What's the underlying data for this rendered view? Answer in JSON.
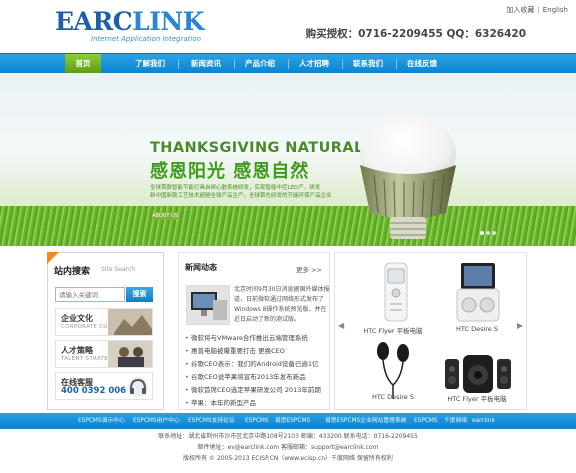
{
  "header": {
    "logo_main": "EARC",
    "logo_rest": "LINK",
    "logo_sub": "Internet Application Integration",
    "top_links": [
      "加入收藏",
      "English"
    ],
    "phone": "购买授权：0716-2209455 QQ：6326420"
  },
  "nav": {
    "items": [
      {
        "label": "首页",
        "active": true
      },
      {
        "label": "了解我们",
        "active": false
      },
      {
        "label": "新闻资讯",
        "active": false
      },
      {
        "label": "产品介绍",
        "active": false
      },
      {
        "label": "人才招聘",
        "active": false
      },
      {
        "label": "联系我们",
        "active": false
      },
      {
        "label": "在线反馈",
        "active": false
      }
    ]
  },
  "banner": {
    "headline_en": "THANKSGIVING NATURAL",
    "headline_cn": "感恩阳光 感恩自然",
    "body_lines": [
      "全球首款智能节能灯具自研心脏系统研发，实现智能中控LED产，研发",
      "新中国新款工艺技术超越全球产品生产，全球首先研发的节能环保产品企业"
    ],
    "more_label": "ABOUT US"
  },
  "search": {
    "title": "站内搜索",
    "subtitle": "Site Search",
    "placeholder": "请输入关键词",
    "button": "搜索"
  },
  "side_boxes": [
    {
      "cn": "企业文化",
      "en": "CORPORATE CULTURE"
    },
    {
      "cn": "人才策略",
      "en": "TALENT STRATEGY"
    },
    {
      "cn": "在线客服",
      "big": "400 0392 006"
    }
  ],
  "news": {
    "title": "新闻动态",
    "more": "更多 >>",
    "excerpt": "北京时间9月30日消息据国外媒体报道，日前微软通过网络形式发布了Windows 8操作系统预览版，并在近日启动了新的测试版。",
    "items": [
      "微软将与VMware合作推出云端管理系统",
      "惠普电脑被曝重要打击 更换CEO",
      "谷歌CEO表示：我们的Android设备已逾1亿",
      "谷歌CEO说苹果将宣布2013年发布新品",
      "微软首席CEO选定苹果研发公司 2013年前期",
      "苹果：本年的新型产品"
    ]
  },
  "products": [
    {
      "label": "HTC Flyer 平板电脑"
    },
    {
      "label": "HTC Desire S"
    },
    {
      "label": "HTC Desire S"
    },
    {
      "label": "HTC Flyer 平板电脑"
    }
  ],
  "links": [
    "ESPCMS演示中心",
    "ESPCMS用户中心",
    "ESPCMS支持论坛",
    "ESPCMS",
    "易思ESPCMS",
    "易思ESPCMS企业网站管理系统",
    "ESPCMS",
    "千度网络",
    "earclink"
  ],
  "footer": {
    "line1": "联系地址：湖北省荆州市沙市区北京中路108号2103 邮编：433200 联系电话：0716-2209455",
    "line2": "邮件地址：ev@earclink.com 客服邮箱：support@earclink.com",
    "line3": "版权所有 © 2005-2013 ECISP.CN（www.ecisp.cn）千度网络 保留所有权利"
  },
  "colors": {
    "nav_blue": "#0b84d0",
    "nav_active_green": "#6aae1b",
    "brand_blue": "#1e5fa8",
    "banner_green": "#3e9b1e",
    "accent_orange": "#f08a1c"
  }
}
